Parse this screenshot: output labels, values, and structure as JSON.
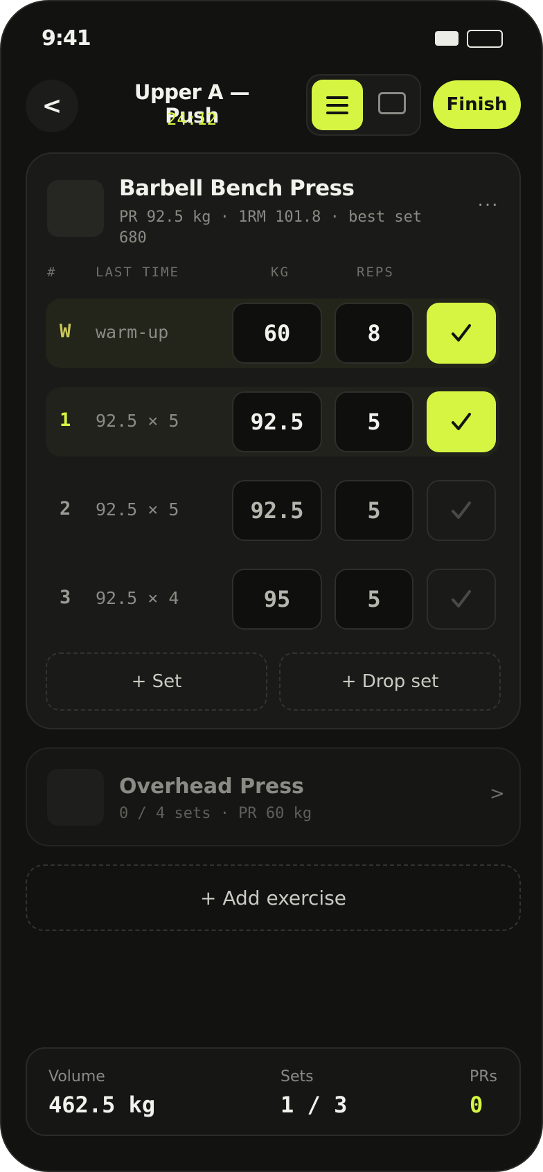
{
  "status": {
    "time": "9:41"
  },
  "header": {
    "back_label": "<",
    "title": "Upper A — Push",
    "timer": "24:12",
    "finish_label": "Finish"
  },
  "exercise1": {
    "name": "Barbell Bench Press",
    "stats": "PR 92.5 kg · 1RM 101.8 · best set 680",
    "more_label": "···",
    "columns": {
      "num": "#",
      "last": "LAST TIME",
      "kg": "KG",
      "reps": "REPS"
    },
    "sets": [
      {
        "num": "W",
        "last": "warm-up",
        "kg": "60",
        "reps": "8",
        "done": true
      },
      {
        "num": "1",
        "last": "92.5 × 5",
        "kg": "92.5",
        "reps": "5",
        "done": true
      },
      {
        "num": "2",
        "last": "92.5 × 5",
        "kg": "92.5",
        "reps": "5",
        "done": false
      },
      {
        "num": "3",
        "last": "92.5 × 4",
        "kg": "95",
        "reps": "5",
        "done": false
      }
    ],
    "add_set_label": "+ Set",
    "add_drop_label": "+ Drop set"
  },
  "exercise2": {
    "name": "Overhead Press",
    "stats": "0 / 4 sets · PR 60 kg",
    "chevron": ">"
  },
  "add_exercise_label": "+ Add exercise",
  "summary": {
    "volume_label": "Volume",
    "volume_value": "462.5 kg",
    "sets_label": "Sets",
    "sets_value": "1 / 3",
    "prs_label": "PRs",
    "prs_value": "0"
  },
  "colors": {
    "accent": "#d6f542",
    "background": "#121311",
    "card": "#1a1b18"
  }
}
